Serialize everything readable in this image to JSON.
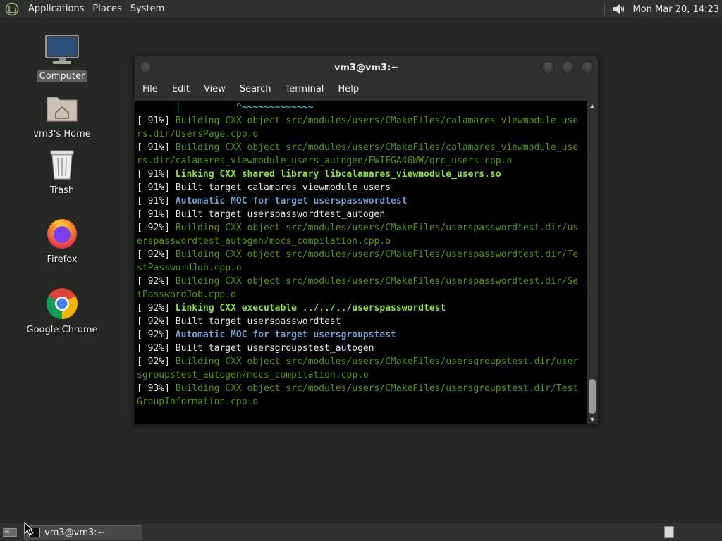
{
  "top_panel": {
    "menus": [
      "Applications",
      "Places",
      "System"
    ],
    "clock": "Mon Mar 20, 14:23"
  },
  "desktop_icons": [
    {
      "label": "Computer",
      "icon": "computer-icon"
    },
    {
      "label": "vm3's Home",
      "icon": "home-folder-icon"
    },
    {
      "label": "Trash",
      "icon": "trash-icon"
    },
    {
      "label": "Firefox",
      "icon": "firefox-icon"
    },
    {
      "label": "Google Chrome",
      "icon": "chrome-icon"
    }
  ],
  "window": {
    "title": "vm3@vm3:~",
    "menus": [
      "File",
      "Edit",
      "View",
      "Search",
      "Terminal",
      "Help"
    ],
    "lines": [
      {
        "t": "       |          ^~~~~~~~~~~~~~",
        "c": "c-cyan"
      },
      {
        "t": "[ 91%] ",
        "c": "c-white",
        "rest": "Building CXX object src/modules/users/CMakeFiles/calamares_viewmodule_use",
        "rc": "c-green"
      },
      {
        "t": "rs.dir/UsersPage.cpp.o",
        "c": "c-green"
      },
      {
        "t": "[ 91%] ",
        "c": "c-white",
        "rest": "Building CXX object src/modules/users/CMakeFiles/calamares_viewmodule_use",
        "rc": "c-green"
      },
      {
        "t": "rs.dir/calamares_viewmodule_users_autogen/EWIEGA46WW/qrc_users.cpp.o",
        "c": "c-green"
      },
      {
        "t": "[ 91%] ",
        "c": "c-white",
        "rest": "Linking CXX shared library libcalamares_viewmodule_users.so",
        "rc": "c-bgreen"
      },
      {
        "t": "[ 91%] Built target calamares_viewmodule_users",
        "c": "c-white"
      },
      {
        "t": "[ 91%] ",
        "c": "c-white",
        "rest": "Automatic MOC for target userspasswordtest",
        "rc": "c-blue"
      },
      {
        "t": "[ 91%] Built target userspasswordtest_autogen",
        "c": "c-white"
      },
      {
        "t": "[ 92%] ",
        "c": "c-white",
        "rest": "Building CXX object src/modules/users/CMakeFiles/userspasswordtest.dir/us",
        "rc": "c-green"
      },
      {
        "t": "erspasswordtest_autogen/mocs_compilation.cpp.o",
        "c": "c-green"
      },
      {
        "t": "[ 92%] ",
        "c": "c-white",
        "rest": "Building CXX object src/modules/users/CMakeFiles/userspasswordtest.dir/Te",
        "rc": "c-green"
      },
      {
        "t": "stPasswordJob.cpp.o",
        "c": "c-green"
      },
      {
        "t": "[ 92%] ",
        "c": "c-white",
        "rest": "Building CXX object src/modules/users/CMakeFiles/userspasswordtest.dir/Se",
        "rc": "c-green"
      },
      {
        "t": "tPasswordJob.cpp.o",
        "c": "c-green"
      },
      {
        "t": "[ 92%] ",
        "c": "c-white",
        "rest": "Linking CXX executable ../../../userspasswordtest",
        "rc": "c-bgreen"
      },
      {
        "t": "[ 92%] Built target userspasswordtest",
        "c": "c-white"
      },
      {
        "t": "[ 92%] ",
        "c": "c-white",
        "rest": "Automatic MOC for target usersgroupstest",
        "rc": "c-blue"
      },
      {
        "t": "[ 92%] Built target usersgroupstest_autogen",
        "c": "c-white"
      },
      {
        "t": "[ 92%] ",
        "c": "c-white",
        "rest": "Building CXX object src/modules/users/CMakeFiles/usersgroupstest.dir/user",
        "rc": "c-green"
      },
      {
        "t": "sgroupstest_autogen/mocs_compilation.cpp.o",
        "c": "c-green"
      },
      {
        "t": "[ 93%] ",
        "c": "c-white",
        "rest": "Building CXX object src/modules/users/CMakeFiles/usersgroupstest.dir/Test",
        "rc": "c-green"
      },
      {
        "t": "GroupInformation.cpp.o",
        "c": "c-green"
      }
    ]
  },
  "taskbar": {
    "task_label": "vm3@vm3:~"
  },
  "colors": {
    "panel": "#2f312f",
    "desktop": "#262826",
    "terminal_bg": "#000000"
  }
}
